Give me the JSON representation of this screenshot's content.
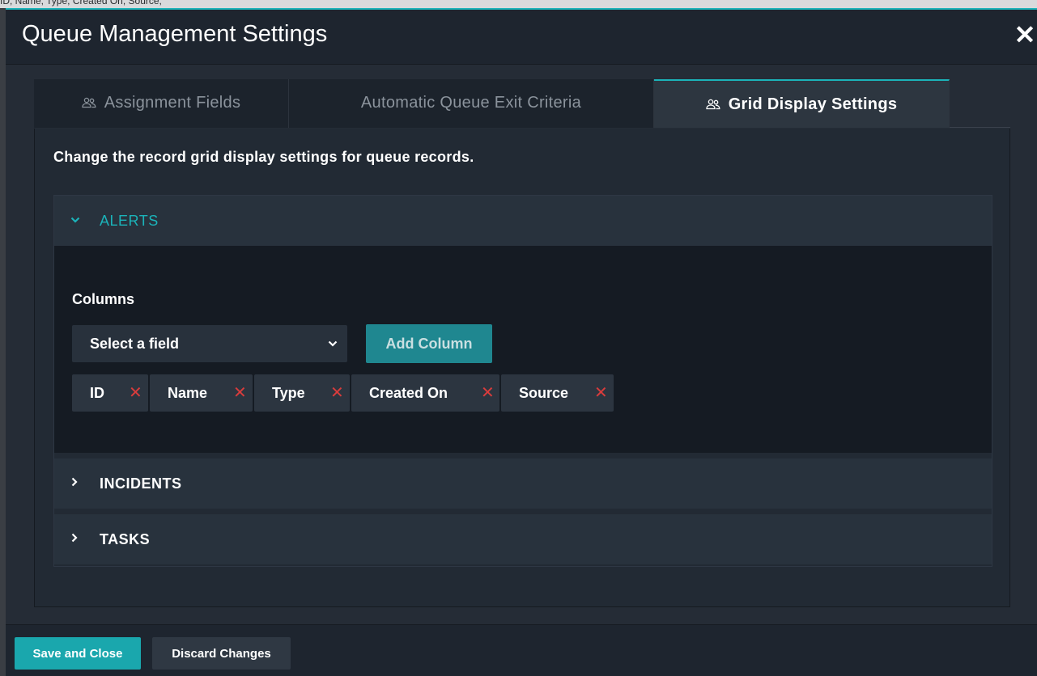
{
  "background_strip": {
    "text": "ID, Name, Type, Created On, Source,"
  },
  "modal": {
    "title": "Queue Management Settings",
    "close_glyph": "✕",
    "accent_color": "#1bb3b9"
  },
  "tabs": [
    {
      "label": "Assignment Fields",
      "icon": "users-icon",
      "active": false
    },
    {
      "label": "Automatic Queue Exit Criteria",
      "icon": "",
      "active": false
    },
    {
      "label": "Grid Display Settings",
      "icon": "users-icon",
      "active": true
    }
  ],
  "content": {
    "description": "Change the record grid display settings for queue records."
  },
  "accordion": {
    "alerts": {
      "label": "ALERTS",
      "expanded": true,
      "columns_label": "Columns",
      "field_select": {
        "value": "Select a field"
      },
      "add_column_label": "Add Column",
      "chips": [
        "ID",
        "Name",
        "Type",
        "Created On",
        "Source"
      ]
    },
    "incidents": {
      "label": "INCIDENTS",
      "expanded": false
    },
    "tasks": {
      "label": "TASKS",
      "expanded": false
    }
  },
  "footer": {
    "save_label": "Save and Close",
    "discard_label": "Discard Changes"
  }
}
